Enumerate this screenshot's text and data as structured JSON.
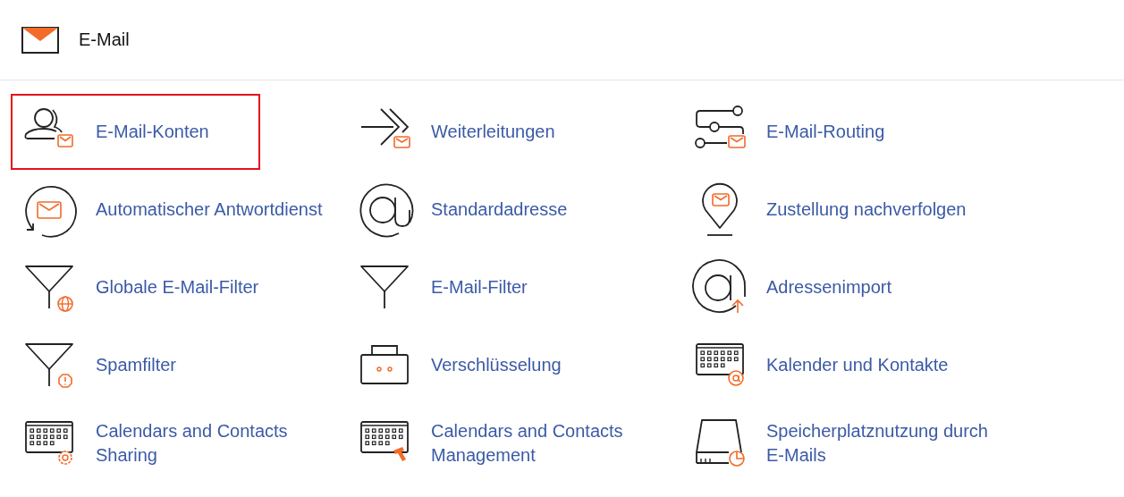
{
  "header": {
    "title": "E-Mail"
  },
  "items": [
    {
      "label": "E-Mail-Konten",
      "selected": true
    },
    {
      "label": "Weiterleitungen",
      "selected": false
    },
    {
      "label": "E-Mail-Routing",
      "selected": false
    },
    {
      "label": "Automatischer Antwortdienst",
      "selected": false
    },
    {
      "label": "Standardadresse",
      "selected": false
    },
    {
      "label": "Zustellung nachverfolgen",
      "selected": false
    },
    {
      "label": "Globale E-Mail-Filter",
      "selected": false
    },
    {
      "label": "E-Mail-Filter",
      "selected": false
    },
    {
      "label": "Adressenimport",
      "selected": false
    },
    {
      "label": "Spamfilter",
      "selected": false
    },
    {
      "label": "Verschlüsselung",
      "selected": false
    },
    {
      "label": "Kalender und Kontakte",
      "selected": false
    },
    {
      "label": "Calendars and Contacts Sharing",
      "selected": false
    },
    {
      "label": "Calendars and Contacts Management",
      "selected": false
    },
    {
      "label": "Speicherplatznutzung durch E-Mails",
      "selected": false
    }
  ]
}
